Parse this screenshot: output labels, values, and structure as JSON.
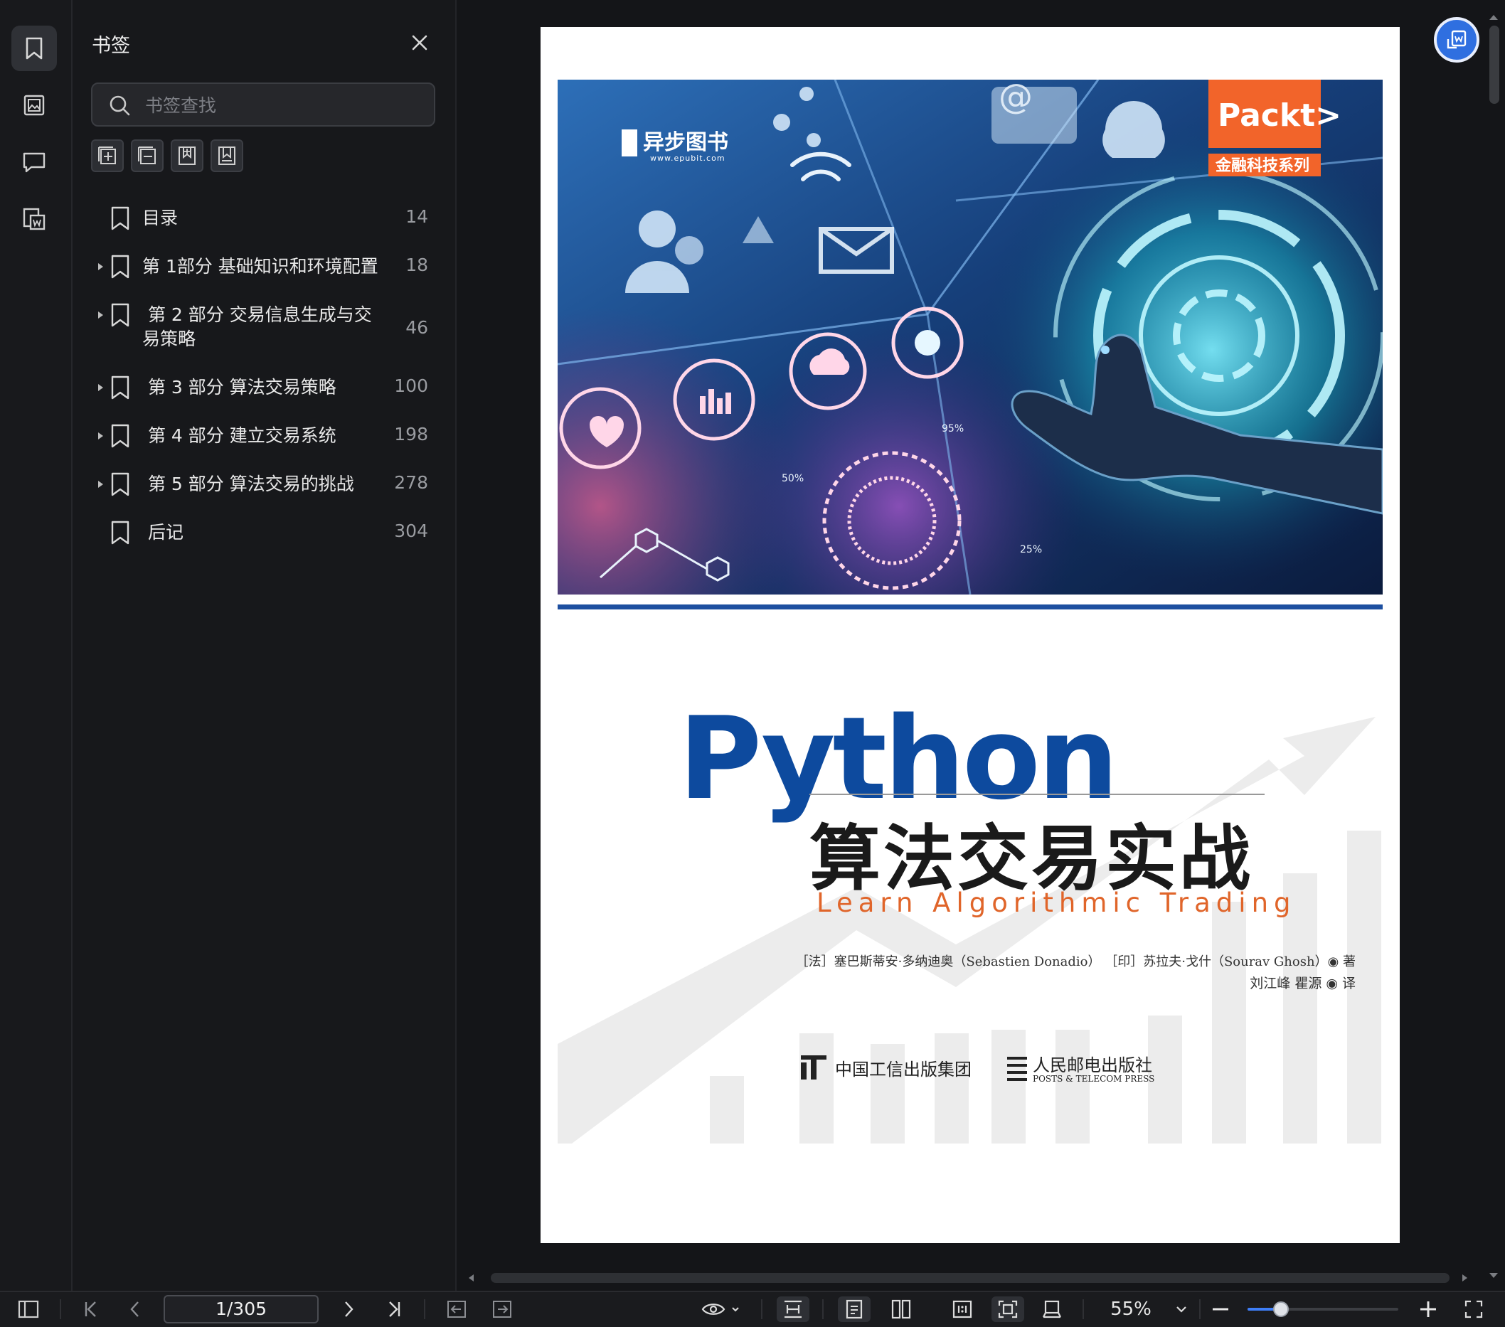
{
  "bookmarks_panel": {
    "title": "书签",
    "search": {
      "placeholder": "书签查找",
      "value": ""
    },
    "items": [
      {
        "label": "目录",
        "page": "14",
        "expandable": false
      },
      {
        "label": "第 1部分 基础知识和环境配置",
        "page": "18",
        "expandable": true
      },
      {
        "label": " 第 2 部分 交易信息生成与交易策略",
        "page": "46",
        "expandable": true
      },
      {
        "label": " 第 3 部分 算法交易策略",
        "page": "100",
        "expandable": true
      },
      {
        "label": " 第 4 部分 建立交易系统",
        "page": "198",
        "expandable": true
      },
      {
        "label": " 第 5 部分 算法交易的挑战",
        "page": "278",
        "expandable": true
      },
      {
        "label": " 后记",
        "page": "304",
        "expandable": false
      }
    ]
  },
  "cover": {
    "publisher_logo": "异步图书",
    "publisher_url": "www.epubit.com",
    "series_brand": "Packt>",
    "series_name": "金融科技系列",
    "title_en": "Python",
    "title_cn": "算法交易实战",
    "subtitle_en": "Learn Algorithmic Trading",
    "authors": "［法］塞巴斯蒂安·多纳迪奥（Sebastien Donadio） ［印］苏拉夫·戈什（Sourav Ghosh）◉ 著",
    "translators": "刘江峰  瞿源 ◉ 译",
    "publisher_1": "中国工信出版集团",
    "publisher_2": "人民邮电出版社",
    "publisher_2_en": "POSTS & TELECOM PRESS",
    "art_labels": [
      "95%",
      "50%",
      "25%"
    ]
  },
  "toolbar": {
    "page_indicator": "1/305",
    "zoom": "55%",
    "zoom_fraction": 0.22
  },
  "colors": {
    "accent": "#3e7ef7",
    "cover_blue": "#0d4a9e",
    "cover_orange": "#e0652a",
    "packt_orange": "#f2642a"
  }
}
